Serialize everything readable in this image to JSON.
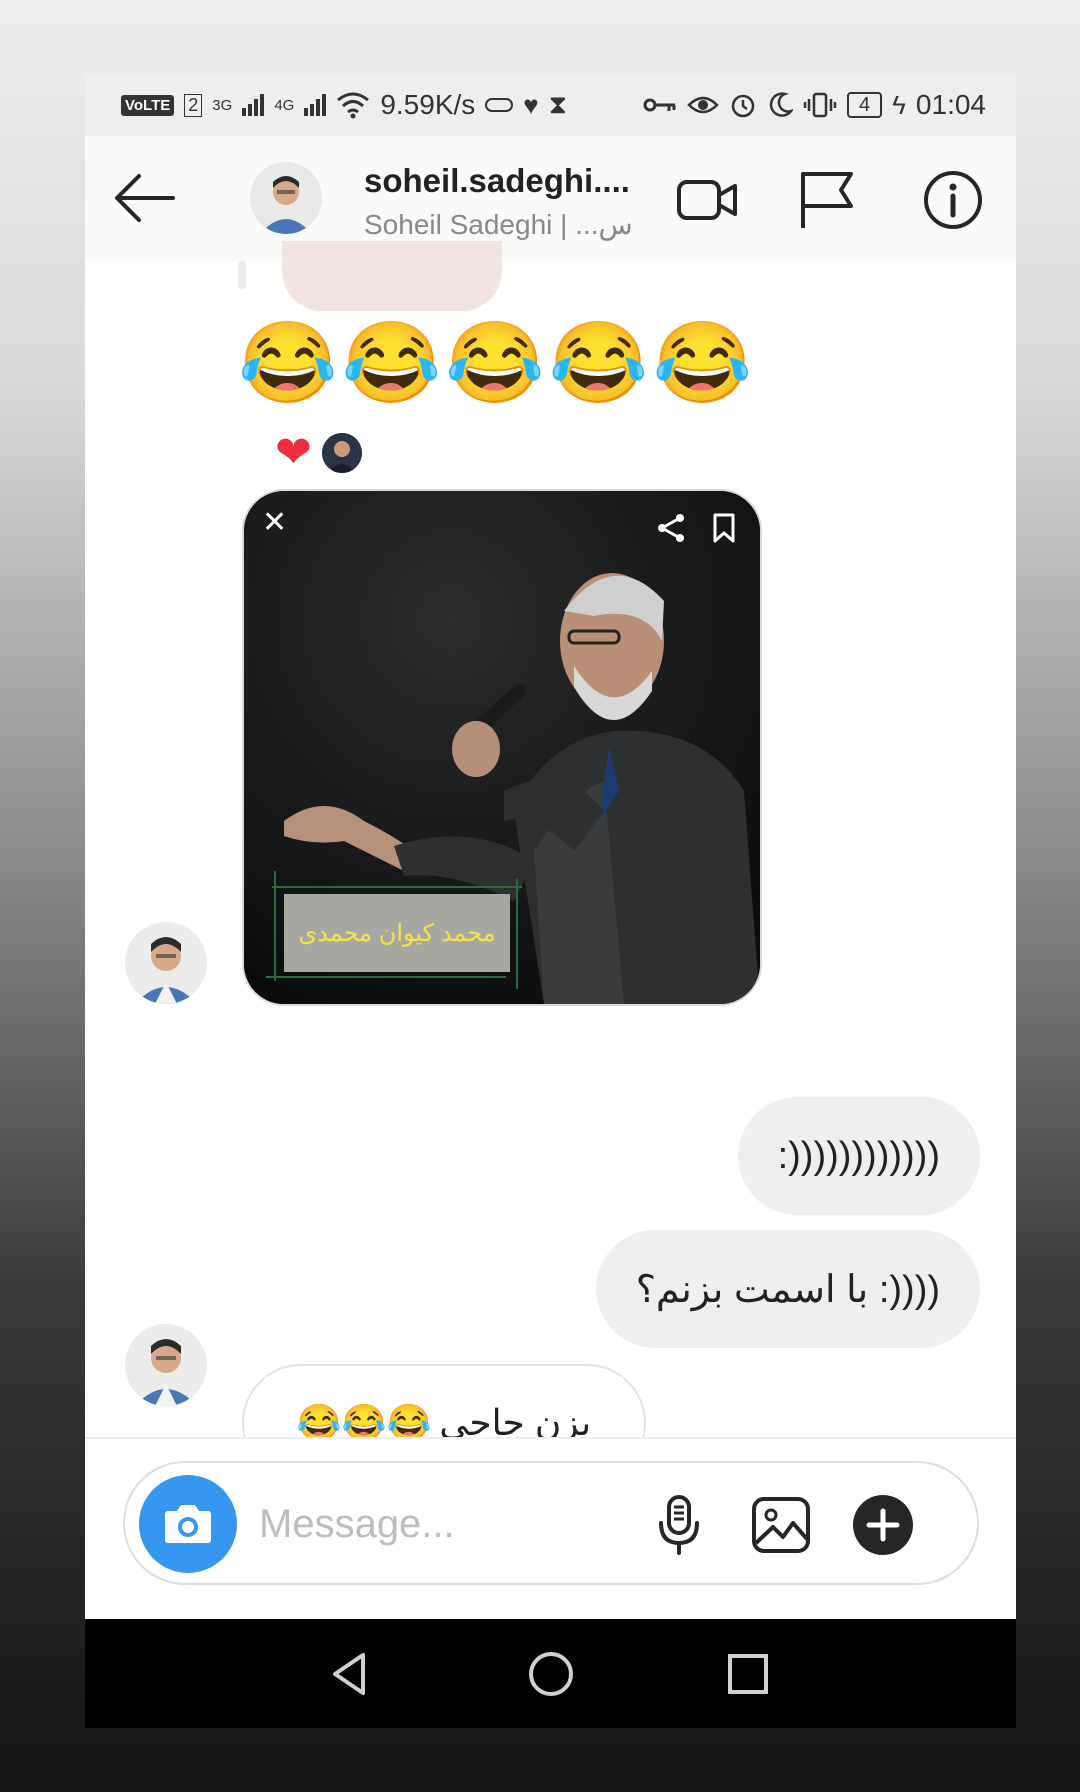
{
  "status_bar": {
    "volte": "VoLTE",
    "sim": "2",
    "net1": "3G",
    "net2": "4G",
    "speed": "9.59K/s",
    "battery": "4",
    "time": "01:04"
  },
  "header": {
    "name": "soheil.sadeghi....",
    "subtitle": "Soheil Sadeghi | ...س"
  },
  "messages": {
    "emoji_burst": "😂😂😂😂😂",
    "reaction_heart": "❤",
    "media_caption": "محمد کیوان محمدی",
    "media_close": "✕",
    "out_1": ":))))))))))))",
    "out_2": "با اسمت بزنم؟ :))))",
    "in_1_text": "بزن حاجی",
    "in_1_emoji": "😂😂😂"
  },
  "composer": {
    "placeholder": "Message..."
  },
  "colors": {
    "accent_blue": "#3797f0",
    "heart_red": "#ed2e3e",
    "caption_yellow": "#f6e34a"
  },
  "icons": [
    "back-arrow-icon",
    "video-call-icon",
    "flag-icon",
    "info-icon",
    "camera-icon",
    "microphone-icon",
    "gallery-icon",
    "plus-icon",
    "share-icon",
    "bookmark-icon",
    "nav-back-icon",
    "nav-home-icon",
    "nav-recents-icon"
  ]
}
